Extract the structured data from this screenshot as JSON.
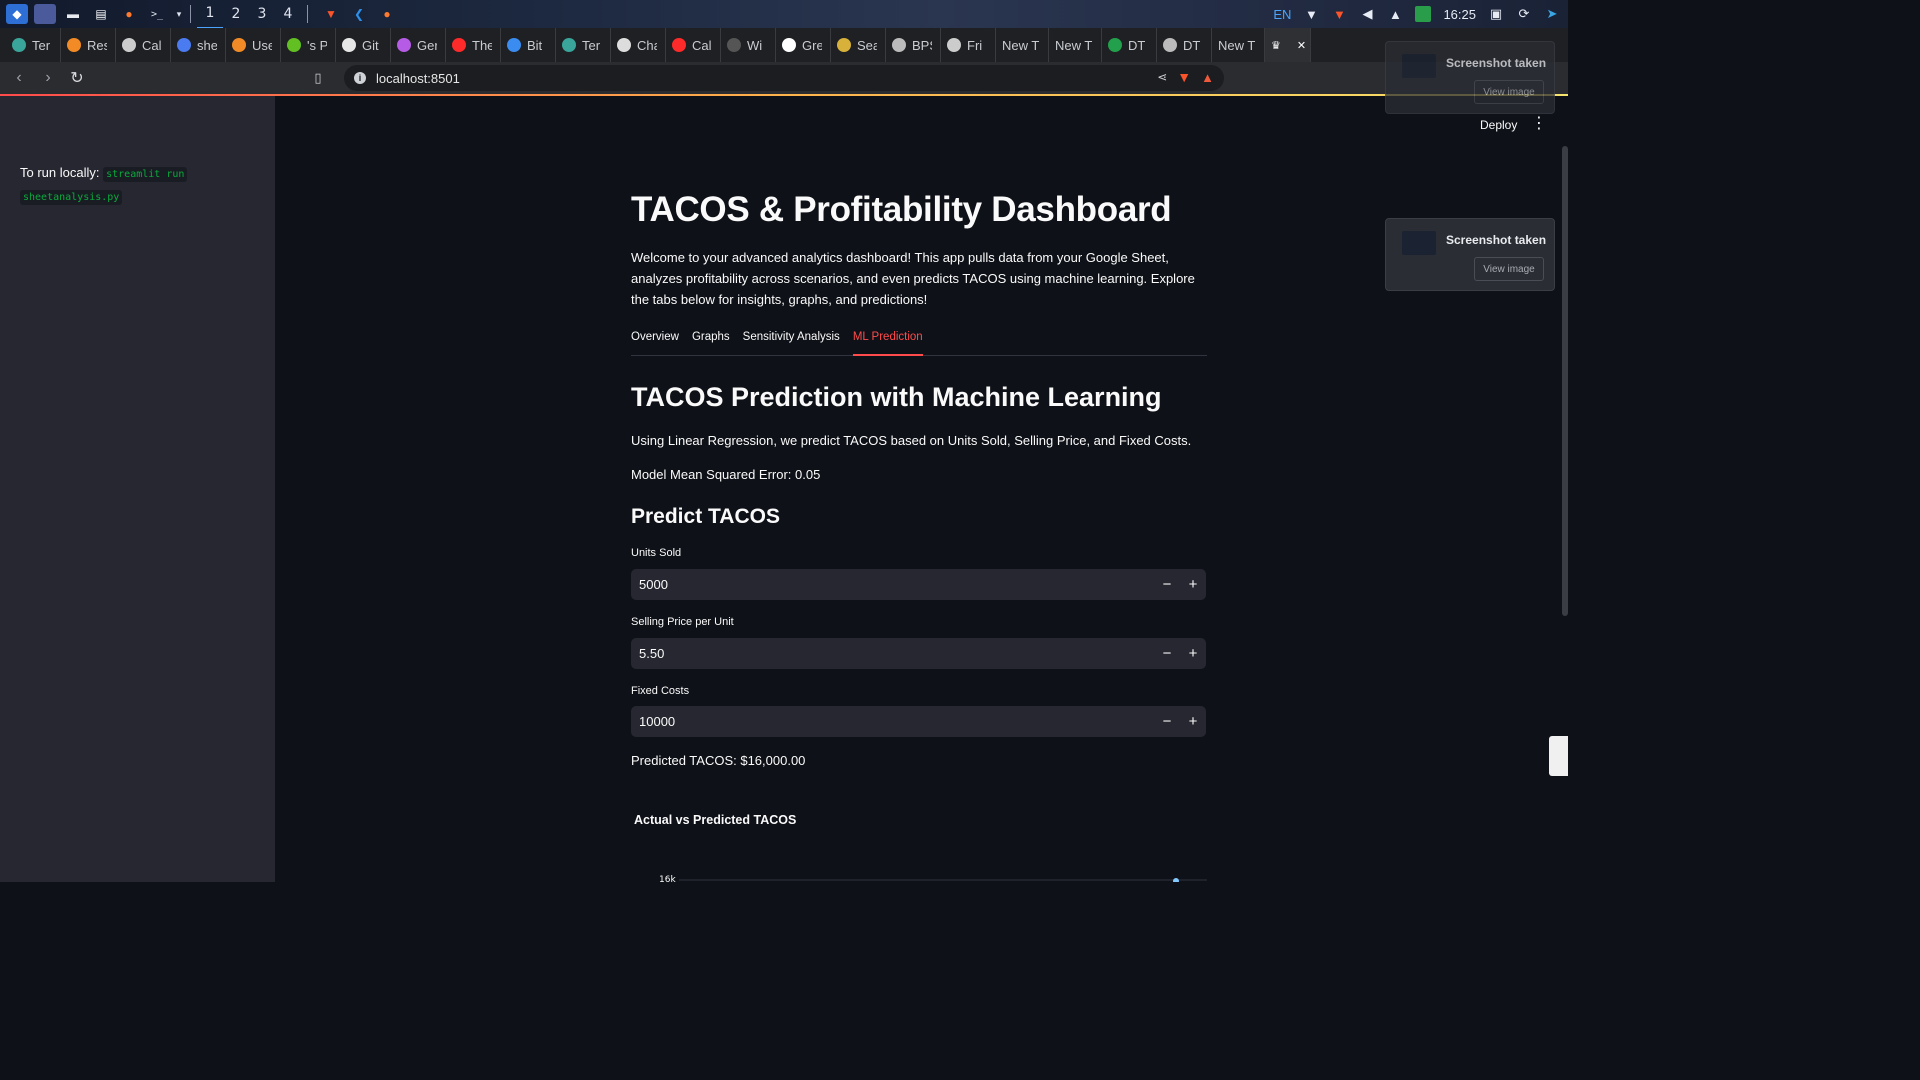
{
  "taskbar": {
    "workspaces": [
      "1",
      "2",
      "3",
      "4"
    ],
    "tray": {
      "language": "EN",
      "time": "16:25"
    }
  },
  "browser": {
    "tabs": [
      {
        "title": "Ter",
        "color": "#3aa59a"
      },
      {
        "title": "Res",
        "color": "#f28b25"
      },
      {
        "title": "Cal",
        "color": "#cccccc"
      },
      {
        "title": "she",
        "color": "#4a7bf0"
      },
      {
        "title": "Use",
        "color": "#f08b27"
      },
      {
        "title": "'s P",
        "color": "#62c022"
      },
      {
        "title": "Git",
        "color": "#e6e6e6"
      },
      {
        "title": "Ger",
        "color": "#b65be6"
      },
      {
        "title": "The",
        "color": "#ff2a2a"
      },
      {
        "title": "Bit",
        "color": "#3a8cf0"
      },
      {
        "title": "Ter",
        "color": "#3aa59a"
      },
      {
        "title": "Cha",
        "color": "#dddddd"
      },
      {
        "title": "Cal",
        "color": "#ff2a2a"
      },
      {
        "title": "Wi",
        "color": "#555555"
      },
      {
        "title": "Gre",
        "color": "#ffffff"
      },
      {
        "title": "Sea",
        "color": "#d8b13a"
      },
      {
        "title": "BPS",
        "color": "#bbbbbb"
      },
      {
        "title": "Fri",
        "color": "#cccccc"
      },
      {
        "title": "New T",
        "color": ""
      },
      {
        "title": "New T",
        "color": ""
      },
      {
        "title": "DT",
        "color": "#22a04b"
      },
      {
        "title": "DT",
        "color": "#bbbbbb"
      },
      {
        "title": "New T",
        "color": ""
      }
    ],
    "url": "localhost:8501"
  },
  "sidebar": {
    "run_locally_label": "To run locally:",
    "command_part1": "streamlit run",
    "command_part2": "sheetanalysis.py"
  },
  "header": {
    "deploy_label": "Deploy"
  },
  "main": {
    "title": "TACOS & Profitability Dashboard",
    "welcome": "Welcome to your advanced analytics dashboard! This app pulls data from your Google Sheet, analyzes profitability across scenarios, and even predicts TACOS using machine learning. Explore the tabs below for insights, graphs, and predictions!",
    "tabs": [
      "Overview",
      "Graphs",
      "Sensitivity Analysis",
      "ML Prediction"
    ],
    "active_tab": "ML Prediction",
    "section_title": "TACOS Prediction with Machine Learning",
    "description": "Using Linear Regression, we predict TACOS based on Units Sold, Selling Price, and Fixed Costs.",
    "mse": "Model Mean Squared Error: 0.05",
    "predict_heading": "Predict TACOS",
    "inputs": [
      {
        "label": "Units Sold",
        "value": "5000"
      },
      {
        "label": "Selling Price per Unit",
        "value": "5.50"
      },
      {
        "label": "Fixed Costs",
        "value": "10000"
      }
    ],
    "predicted": "Predicted TACOS: $16,000.00",
    "chart_title": "Actual vs Predicted TACOS",
    "chart_first_tick": "16k"
  },
  "notifications": [
    {
      "title": "Screenshot taken",
      "button": "View image"
    },
    {
      "title": "Screenshot taken",
      "button": "View image"
    }
  ],
  "colors": {
    "accent": "#ff4b4b",
    "background": "#0e1117",
    "sidebar": "#262730",
    "input": "#262730"
  }
}
